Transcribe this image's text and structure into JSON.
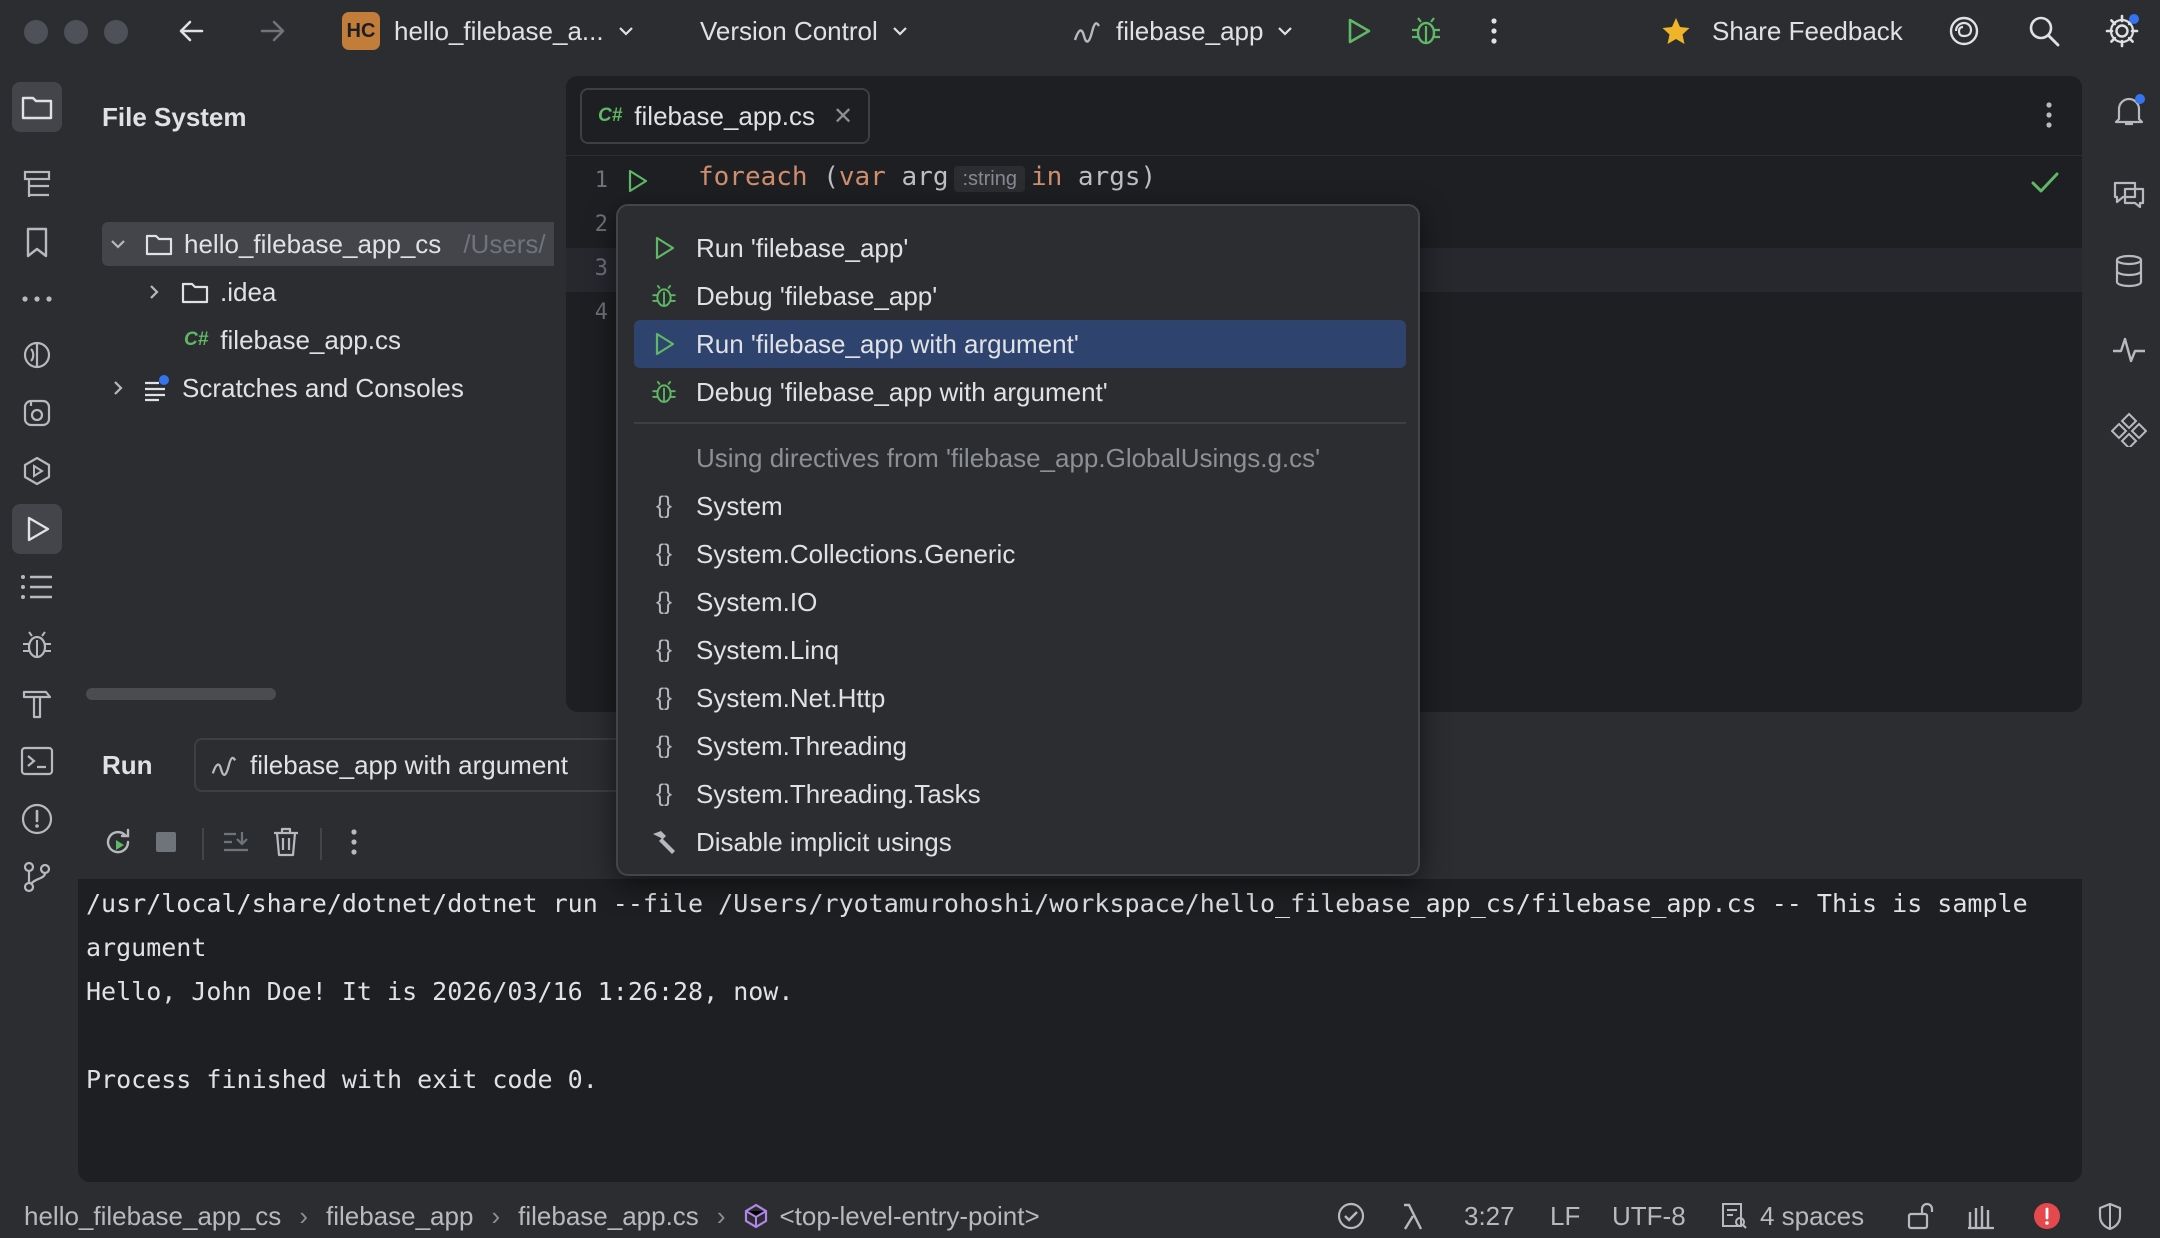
{
  "titlebar": {
    "project_badge": "HC",
    "project_name": "hello_filebase_a...",
    "vcs_label": "Version Control",
    "run_config": "filebase_app",
    "share_feedback": "Share Feedback"
  },
  "file_system": {
    "title": "File System",
    "tree": [
      {
        "label": "hello_filebase_app_cs",
        "hint": "/Users/",
        "type": "folder",
        "expanded": true
      },
      {
        "label": ".idea",
        "type": "folder",
        "expanded": false
      },
      {
        "label": "filebase_app.cs",
        "type": "csharp",
        "badge": "C#"
      },
      {
        "label": "Scratches and Consoles",
        "type": "scratches",
        "expanded": false
      }
    ]
  },
  "editor": {
    "tab_badge": "C#",
    "tab_label": "filebase_app.cs",
    "line_numbers": [
      "1",
      "2",
      "3",
      "4"
    ],
    "code_line1": {
      "kw_foreach": "foreach",
      "paren_open": " (",
      "kw_var": "var",
      "ident_arg": " arg",
      "inlay_hint": ":string",
      "kw_in": "in",
      "rest": " args)"
    }
  },
  "popup": {
    "items": [
      {
        "label": "Run 'filebase_app'",
        "icon": "run-icon"
      },
      {
        "label": "Debug 'filebase_app'",
        "icon": "debug-icon"
      },
      {
        "label": "Run 'filebase_app with argument'",
        "icon": "run-icon",
        "selected": true
      },
      {
        "label": "Debug 'filebase_app with argument'",
        "icon": "debug-icon"
      }
    ],
    "section_header": "Using directives from 'filebase_app.GlobalUsings.g.cs'",
    "usings": [
      "System",
      "System.Collections.Generic",
      "System.IO",
      "System.Linq",
      "System.Net.Http",
      "System.Threading",
      "System.Threading.Tasks"
    ],
    "disable_label": "Disable implicit usings"
  },
  "run_panel": {
    "title": "Run",
    "tab_label": "filebase_app with argument",
    "console_lines": [
      "/usr/local/share/dotnet/dotnet run --file /Users/ryotamurohoshi/workspace/hello_filebase_app_cs/filebase_app.cs -- This is sample argument",
      "Hello, John Doe! It is 2026/03/16 1:26:28, now.",
      "",
      "Process finished with exit code 0."
    ]
  },
  "statusbar": {
    "breadcrumbs": [
      "hello_filebase_app_cs",
      "filebase_app",
      "filebase_app.cs",
      "<top-level-entry-point>"
    ],
    "position": "3:27",
    "line_sep": "LF",
    "encoding": "UTF-8",
    "indent": "4 spaces"
  },
  "colors": {
    "accent_blue": "#3574f0",
    "selection": "#2e436e",
    "run_green": "#5fb865",
    "keyword_orange": "#cf8e6d",
    "error_red": "#e5484d",
    "star_yellow": "#f0b429"
  }
}
